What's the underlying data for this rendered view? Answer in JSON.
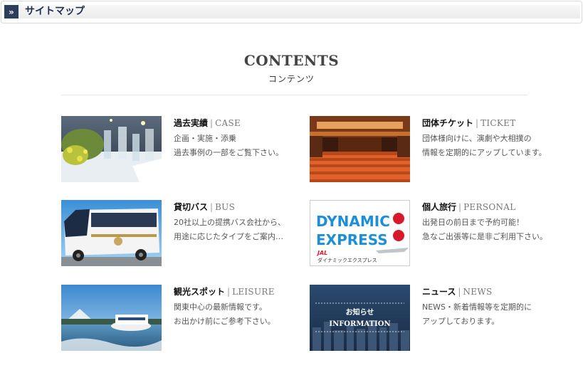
{
  "header": {
    "chevron": "»",
    "title": "サイトマップ"
  },
  "contents": {
    "title": "CONTENTS",
    "subtitle": "コンテンツ"
  },
  "cards": [
    {
      "title_jp": "過去実績",
      "separator": "|",
      "title_en": "CASE",
      "desc": [
        "企画・実施・添乗",
        "過去事例の一部をご覧下さい。"
      ],
      "image": "banquet-table-photo"
    },
    {
      "title_jp": "団体チケット",
      "separator": "|",
      "title_en": "TICKET",
      "desc": [
        "団体様向けに、演劇や大相撲の",
        "情報を定期的にアップしています。"
      ],
      "image": "concert-hall-photo"
    },
    {
      "title_jp": "貸切バス",
      "separator": "|",
      "title_en": "BUS",
      "desc": [
        "20社以上の提携バス会社から、",
        "用途に応じたタイプをご案内…"
      ],
      "image": "tour-bus-photo"
    },
    {
      "title_jp": "個人旅行",
      "separator": "|",
      "title_en": "PERSONAL",
      "desc": [
        "出発日の前日まで予約可能！",
        "急なご出張等に是非ご利用下さい。"
      ],
      "image": "dynamic-express-banner"
    },
    {
      "title_jp": "観光スポット",
      "separator": "|",
      "title_en": "LEISURE",
      "desc": [
        "関東中心の最新情報です。",
        "お出かけ前にご参考下さい。"
      ],
      "image": "lake-boat-photo"
    },
    {
      "title_jp": "ニュース",
      "separator": "|",
      "title_en": "NEWS",
      "desc": [
        "NEWS・新着情報等を定期的に",
        "アップしております。"
      ],
      "image": "city-news-banner"
    }
  ],
  "banners": {
    "dynamic": {
      "line1": "DYNAMIC",
      "line2": "EXPRESS",
      "jal": "JAL",
      "caption": "ダイナミックエクスプレス"
    },
    "news": {
      "jp": "お知らせ",
      "en": "INFORMATION"
    }
  },
  "colors": {
    "header_chevron_bg": "#2b3e5c",
    "header_title": "#1e2f4e",
    "dynamic_blue": "#1e8fd6",
    "jal_red": "#d8182b"
  }
}
